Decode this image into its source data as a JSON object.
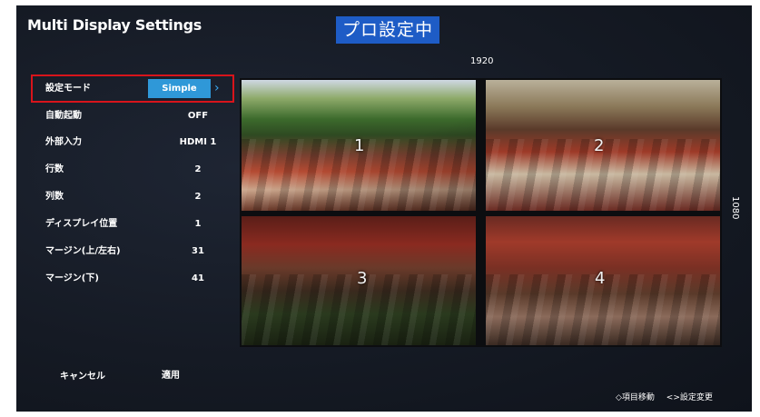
{
  "header": {
    "title": "Multi Display Settings",
    "status_badge": "プロ設定中"
  },
  "preview": {
    "width_label": "1920",
    "height_label": "1080",
    "tiles": [
      "1",
      "2",
      "3",
      "4"
    ]
  },
  "settings": [
    {
      "label": "設定モード",
      "value": "Simple"
    },
    {
      "label": "自動起動",
      "value": "OFF"
    },
    {
      "label": "外部入力",
      "value": "HDMI 1"
    },
    {
      "label": "行数",
      "value": "2"
    },
    {
      "label": "列数",
      "value": "2"
    },
    {
      "label": "ディスプレイ位置",
      "value": "1"
    },
    {
      "label": "マージン(上/左右)",
      "value": "31"
    },
    {
      "label": "マージン(下)",
      "value": "41"
    }
  ],
  "buttons": {
    "cancel": "キャンセル",
    "apply": "適用"
  },
  "footer": {
    "nav_hint": "◇項目移動",
    "change_hint": "<>設定変更"
  },
  "colors": {
    "badge": "#1e5cc6",
    "mode_button": "#2f98d8",
    "focus_border": "#d8141b"
  }
}
